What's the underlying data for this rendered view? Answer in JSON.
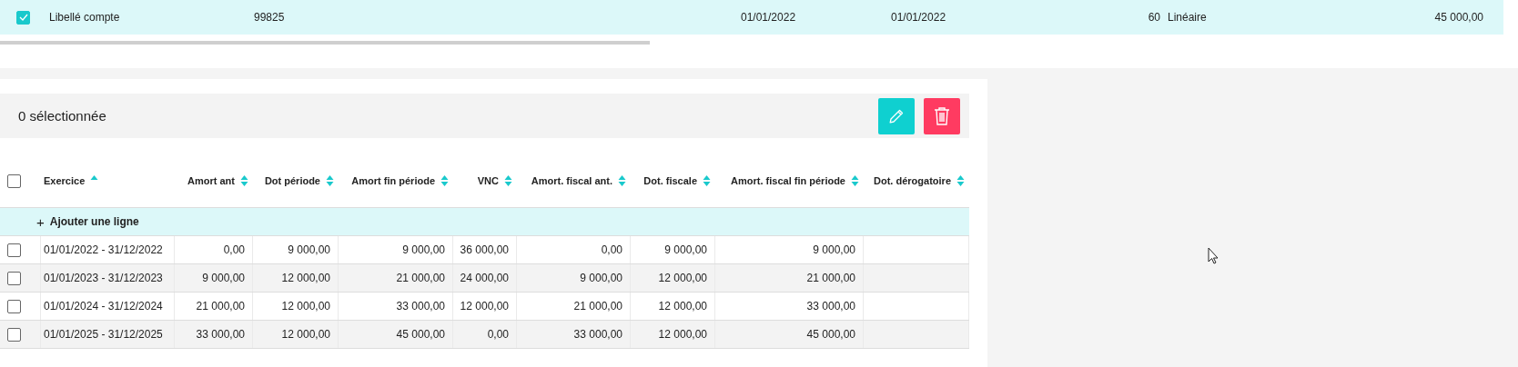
{
  "record_row": {
    "checked": true,
    "cells": [
      "Libellé compte",
      "99825",
      "01/01/2022",
      "01/01/2022",
      "60",
      "Linéaire",
      "45 000,00"
    ]
  },
  "toolbar": {
    "selection_count": "0 sélectionnée"
  },
  "table": {
    "all_checked": false,
    "columns": [
      {
        "label": "Exercice",
        "sorted": true
      },
      {
        "label": "Amort ant",
        "sorted": false
      },
      {
        "label": "Dot période",
        "sorted": false
      },
      {
        "label": "Amort fin période",
        "sorted": false
      },
      {
        "label": "VNC",
        "sorted": false
      },
      {
        "label": "Amort. fiscal ant.",
        "sorted": false
      },
      {
        "label": "Dot. fiscale",
        "sorted": false
      },
      {
        "label": "Amort. fiscal fin période",
        "sorted": false
      },
      {
        "label": "Dot. dérogatoire",
        "sorted": false
      }
    ],
    "add_row": {
      "icon": "+",
      "label": "Ajouter une ligne"
    },
    "rows": [
      {
        "checked": false,
        "cells": [
          "01/01/2022 - 31/12/2022",
          "0,00",
          "9 000,00",
          "9 000,00",
          "36 000,00",
          "0,00",
          "9 000,00",
          "9 000,00"
        ]
      },
      {
        "checked": false,
        "cells": [
          "01/01/2023 - 31/12/2023",
          "9 000,00",
          "12 000,00",
          "21 000,00",
          "24 000,00",
          "9 000,00",
          "12 000,00",
          "21 000,00"
        ]
      },
      {
        "checked": false,
        "cells": [
          "01/01/2024 - 31/12/2024",
          "21 000,00",
          "12 000,00",
          "33 000,00",
          "12 000,00",
          "21 000,00",
          "12 000,00",
          "33 000,00"
        ]
      },
      {
        "checked": false,
        "cells": [
          "01/01/2025 - 31/12/2025",
          "33 000,00",
          "12 000,00",
          "45 000,00",
          "0,00",
          "33 000,00",
          "12 000,00",
          "45 000,00"
        ]
      }
    ]
  }
}
